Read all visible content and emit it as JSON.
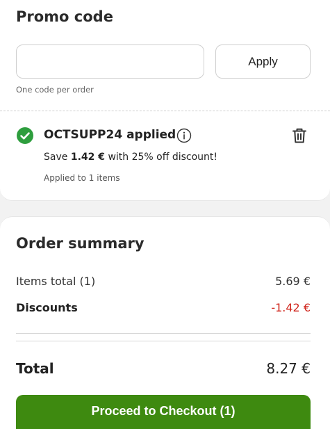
{
  "promo": {
    "title": "Promo code",
    "input_value": "",
    "input_placeholder": "",
    "apply_label": "Apply",
    "hint": "One code per order",
    "applied": {
      "code_text": "OCTSUPP24 applied",
      "save_prefix": "Save ",
      "save_amount": "1.42 €",
      "save_suffix": " with 25% off discount!",
      "items_note": "Applied to 1 items",
      "check_icon": "check-circle-icon",
      "info_icon": "info-icon",
      "delete_icon": "trash-icon",
      "check_color": "#2e9e3e"
    }
  },
  "summary": {
    "title": "Order summary",
    "items_label": "Items total (1)",
    "items_value": "5.69 €",
    "discounts_label": "Discounts",
    "discounts_value": "-1.42 €",
    "discount_color": "#d0261d",
    "total_label": "Total",
    "total_value": "8.27 €",
    "checkout_label": "Proceed to Checkout (1)",
    "checkout_color": "#3e8a10"
  }
}
